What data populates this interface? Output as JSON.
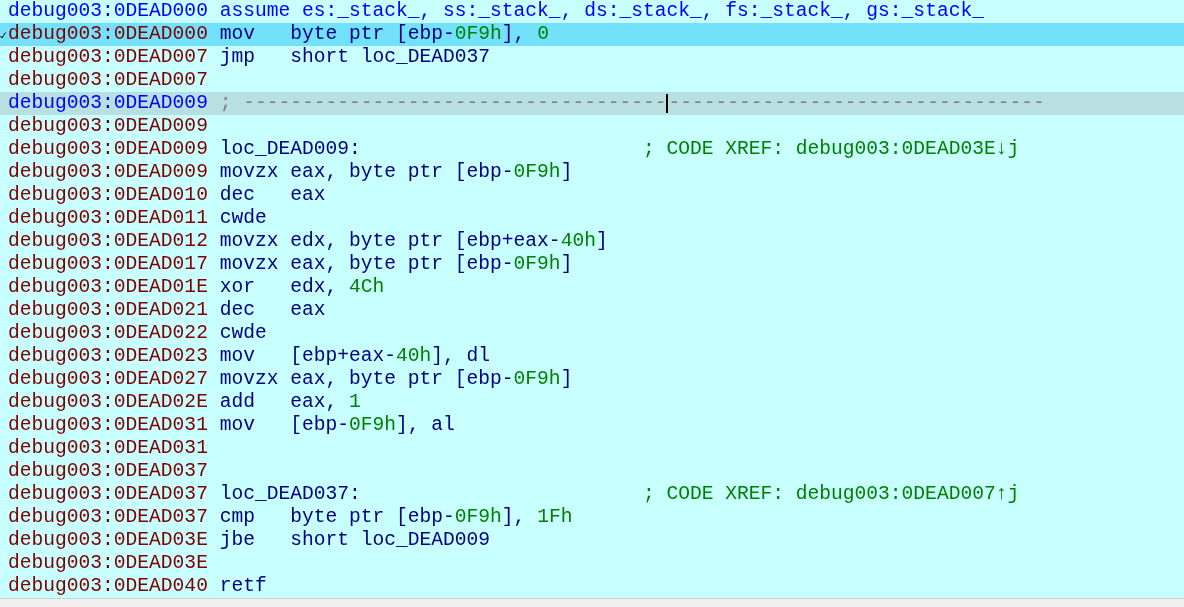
{
  "listing": [
    {
      "kind": "directive",
      "address": "debug003:0DEAD000",
      "text": "assume es:_stack_, ss:_stack_, ds:_stack_, fs:_stack_, gs:_stack_",
      "selected": false,
      "cursor": false
    },
    {
      "kind": "instruction",
      "address": "debug003:0DEAD000",
      "mnemonic": "mov",
      "operands": [
        {
          "text": "byte ptr [ebp-",
          "kind": "plain"
        },
        {
          "text": "0F9h",
          "kind": "number"
        },
        {
          "text": "], ",
          "kind": "plain"
        },
        {
          "text": "0",
          "kind": "number"
        }
      ],
      "selected": true,
      "ip_marker": true
    },
    {
      "kind": "instruction",
      "address": "debug003:0DEAD007",
      "mnemonic": "jmp",
      "operands": [
        {
          "text": "short loc_DEAD037",
          "kind": "plain"
        }
      ],
      "selected": false,
      "cursor": false
    },
    {
      "kind": "blank",
      "address": "debug003:0DEAD007",
      "selected": false,
      "cursor": false
    },
    {
      "kind": "separator",
      "address": "debug003:0DEAD009",
      "text": "; ------------------------------------",
      "text_after_cursor": "--------------------------------",
      "selected": false,
      "cursor": true
    },
    {
      "kind": "blank",
      "address": "debug003:0DEAD009",
      "selected": false,
      "cursor": false
    },
    {
      "kind": "label",
      "address": "debug003:0DEAD009",
      "label": "loc_DEAD009:",
      "comment": "; CODE XREF: debug003:0DEAD03E↓j",
      "selected": false,
      "cursor": false
    },
    {
      "kind": "instruction",
      "address": "debug003:0DEAD009",
      "mnemonic": "movzx",
      "operands": [
        {
          "text": "eax, byte ptr [ebp-",
          "kind": "plain"
        },
        {
          "text": "0F9h",
          "kind": "number"
        },
        {
          "text": "]",
          "kind": "plain"
        }
      ],
      "selected": false,
      "cursor": false
    },
    {
      "kind": "instruction",
      "address": "debug003:0DEAD010",
      "mnemonic": "dec",
      "operands": [
        {
          "text": "eax",
          "kind": "plain"
        }
      ],
      "selected": false,
      "cursor": false
    },
    {
      "kind": "instruction",
      "address": "debug003:0DEAD011",
      "mnemonic": "cwde",
      "selected": false,
      "cursor": false
    },
    {
      "kind": "instruction",
      "address": "debug003:0DEAD012",
      "mnemonic": "movzx",
      "operands": [
        {
          "text": "edx, byte ptr [ebp+eax-",
          "kind": "plain"
        },
        {
          "text": "40h",
          "kind": "number"
        },
        {
          "text": "]",
          "kind": "plain"
        }
      ],
      "selected": false,
      "cursor": false
    },
    {
      "kind": "instruction",
      "address": "debug003:0DEAD017",
      "mnemonic": "movzx",
      "operands": [
        {
          "text": "eax, byte ptr [ebp-",
          "kind": "plain"
        },
        {
          "text": "0F9h",
          "kind": "number"
        },
        {
          "text": "]",
          "kind": "plain"
        }
      ],
      "selected": false,
      "cursor": false
    },
    {
      "kind": "instruction",
      "address": "debug003:0DEAD01E",
      "mnemonic": "xor",
      "operands": [
        {
          "text": "edx, ",
          "kind": "plain"
        },
        {
          "text": "4Ch",
          "kind": "number"
        }
      ],
      "selected": false,
      "cursor": false
    },
    {
      "kind": "instruction",
      "address": "debug003:0DEAD021",
      "mnemonic": "dec",
      "operands": [
        {
          "text": "eax",
          "kind": "plain"
        }
      ],
      "selected": false,
      "cursor": false
    },
    {
      "kind": "instruction",
      "address": "debug003:0DEAD022",
      "mnemonic": "cwde",
      "selected": false,
      "cursor": false
    },
    {
      "kind": "instruction",
      "address": "debug003:0DEAD023",
      "mnemonic": "mov",
      "operands": [
        {
          "text": "[ebp+eax-",
          "kind": "plain"
        },
        {
          "text": "40h",
          "kind": "number"
        },
        {
          "text": "], dl",
          "kind": "plain"
        }
      ],
      "selected": false,
      "cursor": false
    },
    {
      "kind": "instruction",
      "address": "debug003:0DEAD027",
      "mnemonic": "movzx",
      "operands": [
        {
          "text": "eax, byte ptr [ebp-",
          "kind": "plain"
        },
        {
          "text": "0F9h",
          "kind": "number"
        },
        {
          "text": "]",
          "kind": "plain"
        }
      ],
      "selected": false,
      "cursor": false
    },
    {
      "kind": "instruction",
      "address": "debug003:0DEAD02E",
      "mnemonic": "add",
      "operands": [
        {
          "text": "eax, ",
          "kind": "plain"
        },
        {
          "text": "1",
          "kind": "number"
        }
      ],
      "selected": false,
      "cursor": false
    },
    {
      "kind": "instruction",
      "address": "debug003:0DEAD031",
      "mnemonic": "mov",
      "operands": [
        {
          "text": "[ebp-",
          "kind": "plain"
        },
        {
          "text": "0F9h",
          "kind": "number"
        },
        {
          "text": "], al",
          "kind": "plain"
        }
      ],
      "selected": false,
      "cursor": false
    },
    {
      "kind": "blank",
      "address": "debug003:0DEAD031",
      "selected": false,
      "cursor": false
    },
    {
      "kind": "blank",
      "address": "debug003:0DEAD037",
      "selected": false,
      "cursor": false
    },
    {
      "kind": "label",
      "address": "debug003:0DEAD037",
      "label": "loc_DEAD037:",
      "comment": "; CODE XREF: debug003:0DEAD007↑j",
      "selected": false,
      "cursor": false
    },
    {
      "kind": "instruction",
      "address": "debug003:0DEAD037",
      "mnemonic": "cmp",
      "operands": [
        {
          "text": "byte ptr [ebp-",
          "kind": "plain"
        },
        {
          "text": "0F9h",
          "kind": "number"
        },
        {
          "text": "], ",
          "kind": "plain"
        },
        {
          "text": "1Fh",
          "kind": "number"
        }
      ],
      "selected": false,
      "cursor": false
    },
    {
      "kind": "instruction",
      "address": "debug003:0DEAD03E",
      "mnemonic": "jbe",
      "operands": [
        {
          "text": "short loc_DEAD009",
          "kind": "plain"
        }
      ],
      "selected": false,
      "cursor": false
    },
    {
      "kind": "blank",
      "address": "debug003:0DEAD03E",
      "selected": false,
      "cursor": false
    },
    {
      "kind": "instruction",
      "address": "debug003:0DEAD040",
      "mnemonic": "retf",
      "selected": false,
      "cursor": false
    }
  ]
}
